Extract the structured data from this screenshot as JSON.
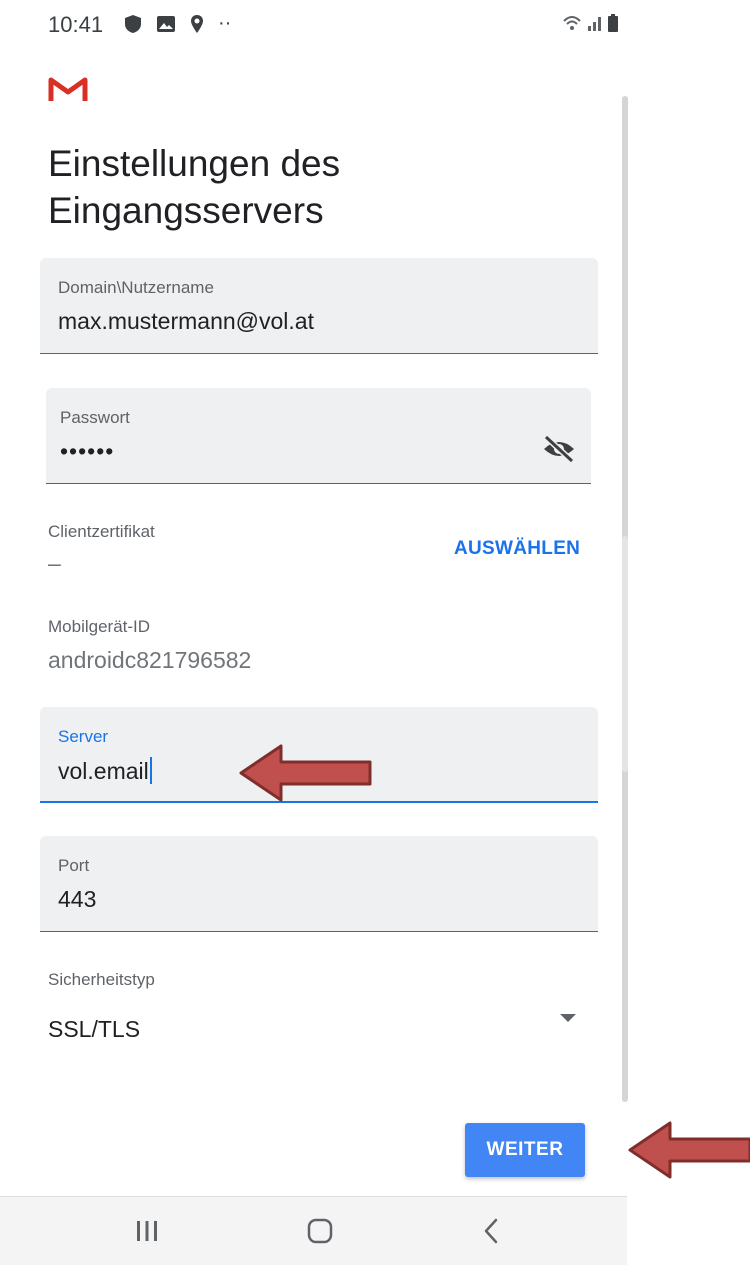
{
  "status": {
    "time": "10:41",
    "more_dots": "··"
  },
  "page": {
    "title_line1": "Einstellungen des",
    "title_line2": "Eingangsservers"
  },
  "fields": {
    "username": {
      "label": "Domain\\Nutzername",
      "value": "max.mustermann@vol.at"
    },
    "password": {
      "label": "Passwort",
      "value": "••••••"
    },
    "server": {
      "label": "Server",
      "value": "vol.email"
    },
    "port": {
      "label": "Port",
      "value": "443"
    }
  },
  "client_cert": {
    "label": "Clientzertifikat",
    "value": "–",
    "action": "AUSWÄHLEN"
  },
  "device_id": {
    "label": "Mobilgerät-ID",
    "value": "androidc821796582"
  },
  "security": {
    "label": "Sicherheitstyp",
    "value": "SSL/TLS"
  },
  "next_button": {
    "label": "WEITER"
  },
  "colors": {
    "accent": "#1a73e8",
    "button": "#4285f4",
    "arrow": "#c0504d",
    "field_bg": "#eef0f1"
  },
  "icons": [
    "shield-icon",
    "image-icon",
    "location-icon",
    "wifi-icon",
    "signal-icon",
    "battery-icon",
    "gmail-logo",
    "visibility-off-icon",
    "dropdown-arrow-icon",
    "recent-apps-icon",
    "home-icon",
    "back-icon"
  ]
}
